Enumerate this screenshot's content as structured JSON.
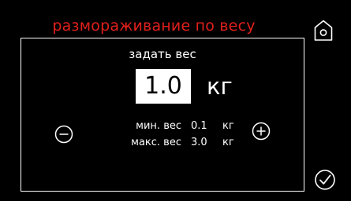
{
  "header": {
    "title": "размораживание по весу",
    "title_color": "#e0201c",
    "home_icon": "home-icon"
  },
  "panel": {
    "subtitle": "задать вес",
    "weight_value": "1.0",
    "weight_unit": "кг",
    "decrease_icon": "minus-circle-icon",
    "increase_icon": "plus-circle-icon",
    "limits": {
      "min_label": "мин. вес",
      "min_value": "0.1",
      "min_unit": "кг",
      "max_label": "макс. вес",
      "max_value": "3.0",
      "max_unit": "кг"
    }
  },
  "footer": {
    "confirm_icon": "checkmark-circle-icon"
  }
}
